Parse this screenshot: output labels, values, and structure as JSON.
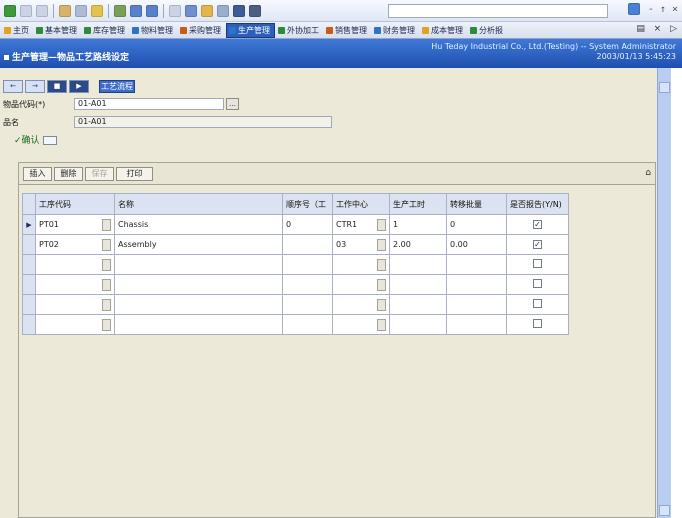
{
  "top_bar": {
    "right_glyphs": "- ↑ ×"
  },
  "module_tabs": [
    {
      "label": "主页",
      "color": "#e3a11c"
    },
    {
      "label": "基本管理",
      "color": "#2f8a3c"
    },
    {
      "label": "库存管理",
      "color": "#2f8a3c"
    },
    {
      "label": "物料管理",
      "color": "#2c74c9"
    },
    {
      "label": "采购管理",
      "color": "#c85b17"
    },
    {
      "label": "生产管理",
      "color": "#2c74c9",
      "active": true
    },
    {
      "label": "外协加工",
      "color": "#2f8a3c"
    },
    {
      "label": "销售管理",
      "color": "#c85b17"
    },
    {
      "label": "财务管理",
      "color": "#2c74c9"
    },
    {
      "label": "成本管理",
      "color": "#e3a11c"
    },
    {
      "label": "分析报",
      "color": "#2f8a3c"
    }
  ],
  "module_controls": "▤ × ▷",
  "banner": {
    "title": "生产管理—物品工艺路线设定",
    "company": "Hu Teday Industrial Co., Ltd.(Testing)   -- System Administrator",
    "datetime": "2003/01/13 5:45:23"
  },
  "nav_buttons": [
    "←",
    "→",
    "■",
    "▶"
  ],
  "tool_tab": "工艺流程",
  "form": {
    "item_code_label": "物品代码(*)",
    "item_code_value": "01-A01",
    "item_name_label": "品名",
    "item_name_value": "01-A01",
    "confirm_label": "✓确认"
  },
  "grid_toolbar": {
    "insert": "插入",
    "delete": "删除",
    "save": "保存",
    "print": "打印",
    "pin": "⌂"
  },
  "grid": {
    "columns": [
      "工序代码",
      "名称",
      "顺序号（工",
      "工作中心",
      "生产工时",
      "转移批量",
      "是否报告(Y/N)"
    ],
    "rows": [
      {
        "marker": "▶",
        "code": "PT01",
        "name": "Chassis",
        "seq": "0",
        "center": "CTR1",
        "hours": "1",
        "batch": "0",
        "report": true
      },
      {
        "marker": "",
        "code": "PT02",
        "name": "Assembly",
        "seq": "",
        "center": "03",
        "hours": "2.00",
        "batch": "0.00",
        "report": true
      },
      {
        "marker": "",
        "code": "",
        "name": "",
        "seq": "",
        "center": "",
        "hours": "",
        "batch": "",
        "report": false
      },
      {
        "marker": "",
        "code": "",
        "name": "",
        "seq": "",
        "center": "",
        "hours": "",
        "batch": "",
        "report": false
      },
      {
        "marker": "",
        "code": "",
        "name": "",
        "seq": "",
        "center": "",
        "hours": "",
        "batch": "",
        "report": false
      },
      {
        "marker": "",
        "code": "",
        "name": "",
        "seq": "",
        "center": "",
        "hours": "",
        "batch": "",
        "report": false
      }
    ]
  },
  "colors": {
    "accent": "#2c5fb8",
    "banner": "#1f4fae",
    "panel": "#ece9d8"
  }
}
